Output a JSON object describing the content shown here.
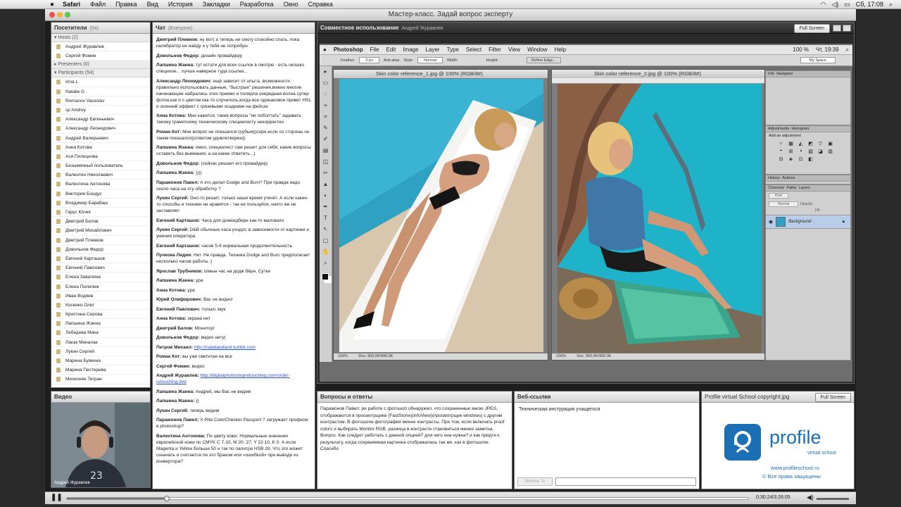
{
  "menubar": {
    "items": [
      "Safari",
      "Файл",
      "Правка",
      "Вид",
      "История",
      "Закладки",
      "Разработка",
      "Окно",
      "Справка"
    ],
    "clock": "Сб, 17:08"
  },
  "window": {
    "title": "Мастер-класс. Задай вопрос эксперту"
  },
  "attendees": {
    "title": "Посетители",
    "count": "(54)",
    "hosts_label": "Hosts (2)",
    "hosts": [
      "Андрей Журавлев",
      "Сергей Фомин"
    ],
    "presenters_label": "Presenters (0)",
    "participants_label": "Participants (54)",
    "participants": [
      "Irina L",
      "Natalie G",
      "Romanov Vaceslav",
      "sp Andrey",
      "Александр Евгеньевич",
      "Александр Леонидович",
      "Андрей Валерьевич",
      "Анна Котова",
      "Ася Пилецкова",
      "Безымянный пользователь",
      "Валентин Николаевич",
      "Валентина Антонова",
      "Виктория Бондус",
      "Владимир Барабаш",
      "Гарус Юлия",
      "Дмитрий Белов",
      "Дмитрий Михайлович",
      "Дмитрий Плевков",
      "Довольнов Федор",
      "Евгений Карташов",
      "Евгений Павлович",
      "Елена Завалина",
      "Елена Пилипюк",
      "Иван Водяев",
      "Косенко Олег",
      "Кристина Серова",
      "Лапшина Жанна",
      "Лебедева Мика",
      "Лакак Миналак",
      "Лукин Сергей",
      "Марина Буякина",
      "Марина Пестерева",
      "Мехконян Тигран"
    ]
  },
  "video": {
    "title": "Видео",
    "name_label": "Андрей Журавлев"
  },
  "chat": {
    "title": "Чат",
    "scope": "(Everyone)",
    "messages": [
      {
        "author": "Дмитрий Плевков:",
        "text": "ну вот( а теперь не смогу спокойно спать, пока калибратор не найду и у тебя не попробую"
      },
      {
        "author": "Довольнов Федор:",
        "text": "дизайн провайдеру"
      },
      {
        "author": "Лапшина Жанна:",
        "text": "тут кстати для всех ссылок в смотрю - есть окошко специоое... лучше наверное туда ссылки..."
      },
      {
        "author": "Александр Леонидович:",
        "text": "ещё зависит от опыта, возможности правильно использовать данные, \"быстрые\" решения,вижно многие начинающие набрались этих приемо и полярла очередная волна супер фоток,как и с цветом как-то случилось,когда все одинаковое привет HSL и осенний эффект с грязевыми осадками на фейсах"
      },
      {
        "author": "Анна Котова:",
        "text": "Мне кажется, такие вопросы \"не поболтать\" задавать такому грамотному техническому специалисту некорректно."
      },
      {
        "author": "Роман Кот:",
        "text": "Мне вопрос не показался грубым))сори,если со стороны он таким показался))ответом удовлетворен))"
      },
      {
        "author": "Лапшина Жанна:",
        "text": "имхо, специалист сам решит для себя, какие вопросы оставить без внимания, а на какие ответить...)"
      },
      {
        "author": "Довольнов Федор:",
        "text": "(сейчас решает его провайдер)"
      },
      {
        "author": "Лапшина Жанна:",
        "text": "))))"
      },
      {
        "author": "Парамонов Павел:",
        "text": "А кто делал Dodge and Burn? При правда надо охоло часа на эту обработку ?"
      },
      {
        "author": "Лукин Сергей:",
        "text": "Оно-то решит, только наше время утечёт. А если какие-то способы и техники не нравятся - так не пользуйся, никто же не заставляет"
      },
      {
        "author": "Евгений Карташов:",
        "text": "Часа для дожендберн как-то маловато"
      },
      {
        "author": "Лукин Сергей:",
        "text": "D&B обычные часа уходит, в зависимости от картинки и умения оператора"
      },
      {
        "author": "Евгений Карташов:",
        "text": "часов 5-6 нормальная продолжительность"
      },
      {
        "author": "Пучкова Лидия:",
        "text": "Нет. Не правда. Техника Dodge and Burn предполагает несколько часов работы :)"
      },
      {
        "author": "Ярослав Трубников:",
        "text": "Ымын час на додж бёрн. Сутки"
      },
      {
        "author": "Лапшина Жанна:",
        "text": "ура"
      },
      {
        "author": "Анна Котова:",
        "text": "ура"
      },
      {
        "author": "Юрий Олифирович:",
        "text": "Вас не видно!"
      },
      {
        "author": "Евгений Павлович:",
        "text": "только звук"
      },
      {
        "author": "Анна Котова:",
        "text": "экрана нет"
      },
      {
        "author": "Дмитрий Белов:",
        "text": "Монитор!"
      },
      {
        "author": "Довольнов Федор:",
        "text": "видео нету("
      },
      {
        "author": "Петров Михаил:",
        "link": "http://nataliatafarel.tumblr.com"
      },
      {
        "author": "Роман Кот:",
        "text": "вы уже светитая на все"
      },
      {
        "author": "Сергей Фомин:",
        "text": "видео"
      },
      {
        "author": "Андрей Журавлев:",
        "link": "http://digitalphotoshopretouching.com/order-retouching.dvd"
      },
      {
        "author": "Лапшина Жанна:",
        "text": "Андрей, мы Вас не видим"
      },
      {
        "author": "Лапшина Жанна:",
        "text": "))"
      },
      {
        "author": "Лукин Сергей:",
        "text": "теперь видим"
      },
      {
        "author": "Парамонов Павел:",
        "text": "X-Rite ColorChecker Passport ?  загружает профили в photoshop?"
      },
      {
        "author": "Валентина Антонова:",
        "text": "По цвету кожи: Нормальные значения европейской кожи по CMYK C 7-10, M 20- 27, Y 22-10, K 0. А если Magenta и Yellow больше 50 и так по палитре HSB 28. Что это может означать и считается ли это браком или «ошибкой» при выводе из конвертора?"
      }
    ]
  },
  "share": {
    "title": "Совместное использование",
    "presenter": "Андрей Журавлев",
    "fullscreen_label": "Full Screen"
  },
  "photoshop": {
    "menu": [
      "Photoshop",
      "File",
      "Edit",
      "Image",
      "Layer",
      "Type",
      "Select",
      "Filter",
      "View",
      "Window",
      "Help"
    ],
    "zoom_status": "100 %",
    "clock": "Чт, 19:39",
    "workspace": "My Space",
    "options": {
      "feather_label": "Feather:",
      "feather_value": "0 px",
      "antialias": "Anti-alias",
      "style_label": "Style:",
      "style_value": "Normal",
      "width_label": "Width:",
      "height_label": "Height:",
      "refine_label": "Refine Edge..."
    },
    "doc1": {
      "title": "Skin color reference_1.jpg @ 100% (RGB/8#)",
      "zoom": "100%",
      "info": "Doc: 900,0K/900,0K"
    },
    "doc2": {
      "title": "Skin color reference_2.jpg @ 100% (RGB/8#)",
      "zoom": "100%",
      "info": "Doc: 900,0K/900,0K"
    },
    "info_tabs": [
      "Info",
      "Navigator"
    ],
    "adj_tabs": [
      "Adjustments",
      "Histogram"
    ],
    "adj_label": "Add an adjustment",
    "history_tabs": [
      "History",
      "Actions"
    ],
    "layer_tabs": [
      "Channels",
      "Paths",
      "Layers"
    ],
    "layer_kind": "Kind",
    "layer_mode": "Normal",
    "opacity_label": "Opacity:",
    "fill_label": "Fill:",
    "layer_name": "Background"
  },
  "qa": {
    "title": "Вопросы и ответы",
    "text": "Парамонов Павел: ри работе с фотошоп обнаружил, что сохраненные мною JPEG, отображаются в просмотрщике (FastStone)(infoView)(просмотрщик windows) с другим контрастом. В фотошопе фотография менее контрасты. При том, если включать proof colors и выбирать Monitor RGB, разница в контрасте становиться менее заметна. Вопрос: Как следует работать с данной опцией? для чего она нужна? и как придти к результату, когда сохраняемая картинка отображалась так же, как в фотошопе. Спасибо"
  },
  "weblinks": {
    "title": "Веб-ссылки",
    "item": "Техническая инструкция учащегося",
    "button": "Browse To"
  },
  "file": {
    "title": "Profile virtual School copyright.jpg",
    "fullscreen_label": "Full Screen",
    "logo_word": "profile",
    "logo_sub": "virtual school",
    "site": "www.profileschool.ru",
    "rights": "© Все права защищены"
  },
  "player": {
    "time": "0:30:24/3:26:05",
    "progress": 0.147
  },
  "colors": {
    "accent": "#1a6fb5",
    "ps_bg": "#7a7a7a",
    "layer_selected": "#b8cde8"
  }
}
